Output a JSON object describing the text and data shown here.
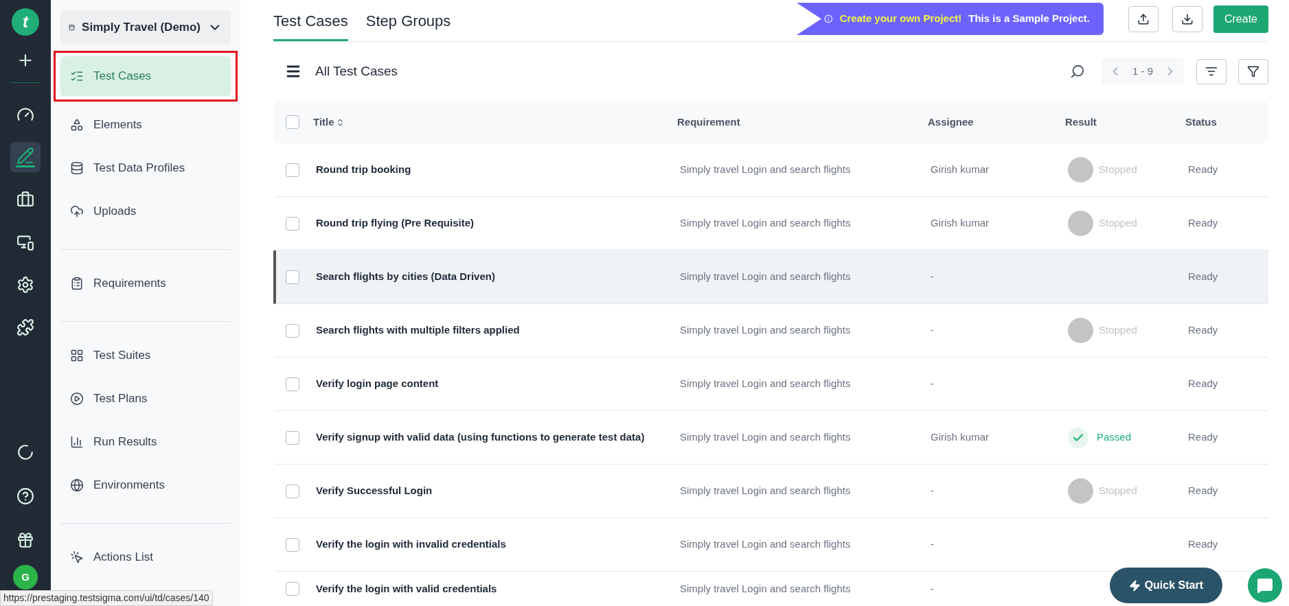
{
  "rail": {
    "logo": "t",
    "top": [
      {
        "selected": false
      }
    ],
    "items": [
      {
        "selected": false
      },
      {
        "selected": true
      },
      {
        "selected": false
      },
      {
        "selected": false
      },
      {
        "selected": false
      },
      {
        "selected": false
      }
    ],
    "bottom": [
      {
        "selected": false
      },
      {
        "selected": false
      },
      {
        "selected": false
      }
    ],
    "avatar": "G"
  },
  "project": {
    "name": "Simply Travel (Demo)"
  },
  "sidebar": {
    "groups": [
      [
        {
          "label": "Test Cases",
          "selected": true,
          "highlighted": true
        },
        {
          "label": "Elements",
          "selected": false,
          "highlighted": false
        },
        {
          "label": "Test Data Profiles",
          "selected": false,
          "highlighted": false
        },
        {
          "label": "Uploads",
          "selected": false,
          "highlighted": false
        }
      ],
      [
        {
          "label": "Requirements",
          "selected": false,
          "highlighted": false
        }
      ],
      [
        {
          "label": "Test Suites",
          "selected": false,
          "highlighted": false
        },
        {
          "label": "Test Plans",
          "selected": false,
          "highlighted": false
        },
        {
          "label": "Run Results",
          "selected": false,
          "highlighted": false
        },
        {
          "label": "Environments",
          "selected": false,
          "highlighted": false
        }
      ],
      [
        {
          "label": "Actions List",
          "selected": false,
          "highlighted": false
        }
      ]
    ]
  },
  "tabs": [
    {
      "label": "Test Cases",
      "selected": true
    },
    {
      "label": "Step Groups",
      "selected": false
    }
  ],
  "banner": {
    "highlight": "Create your own Project!",
    "text": "This is a Sample Project."
  },
  "create_button": "Create",
  "list": {
    "title": "All Test Cases",
    "pager": "1 - 9"
  },
  "table": {
    "all_checked": false,
    "columns": [
      "Title",
      "Requirement",
      "Assignee",
      "Result",
      "Status"
    ],
    "rows": [
      {
        "selected": false,
        "title": "Round trip booking",
        "requirement": "Simply travel Login and search flights",
        "assignee": "Girish kumar",
        "result": {
          "kind": "stopped",
          "label": "Stopped"
        },
        "status": "Ready"
      },
      {
        "selected": false,
        "title": "Round trip flying (Pre Requisite)",
        "requirement": "Simply travel Login and search flights",
        "assignee": "Girish kumar",
        "result": {
          "kind": "stopped",
          "label": "Stopped"
        },
        "status": "Ready"
      },
      {
        "selected": true,
        "title": "Search flights by cities (Data Driven)",
        "requirement": "Simply travel Login and search flights",
        "assignee": "-",
        "status": "Ready"
      },
      {
        "selected": false,
        "title": "Search flights with multiple filters applied",
        "requirement": "Simply travel Login and search flights",
        "assignee": "-",
        "result": {
          "kind": "stopped",
          "label": "Stopped"
        },
        "status": "Ready"
      },
      {
        "selected": false,
        "title": "Verify login page content",
        "requirement": "Simply travel Login and search flights",
        "assignee": "-",
        "status": "Ready"
      },
      {
        "selected": false,
        "title": "Verify signup with valid data (using functions to generate test data)",
        "requirement": "Simply travel Login and search flights",
        "assignee": "Girish kumar",
        "result": {
          "kind": "passed",
          "label": "Passed"
        },
        "status": "Ready"
      },
      {
        "selected": false,
        "title": "Verify Successful Login",
        "requirement": "Simply travel Login and search flights",
        "assignee": "-",
        "result": {
          "kind": "stopped",
          "label": "Stopped"
        },
        "status": "Ready"
      },
      {
        "selected": false,
        "title": "Verify the login with invalid credentials",
        "requirement": "Simply travel Login and search flights",
        "assignee": "-",
        "status": "Ready"
      },
      {
        "selected": false,
        "title": "Verify the login with valid credentials",
        "requirement": "Simply travel Login and search flights",
        "assignee": "-"
      }
    ]
  },
  "quick_start": "Quick Start",
  "status_bar": {
    "url": "https://prestaging.testsigma.com/ui/td/cases/140"
  }
}
